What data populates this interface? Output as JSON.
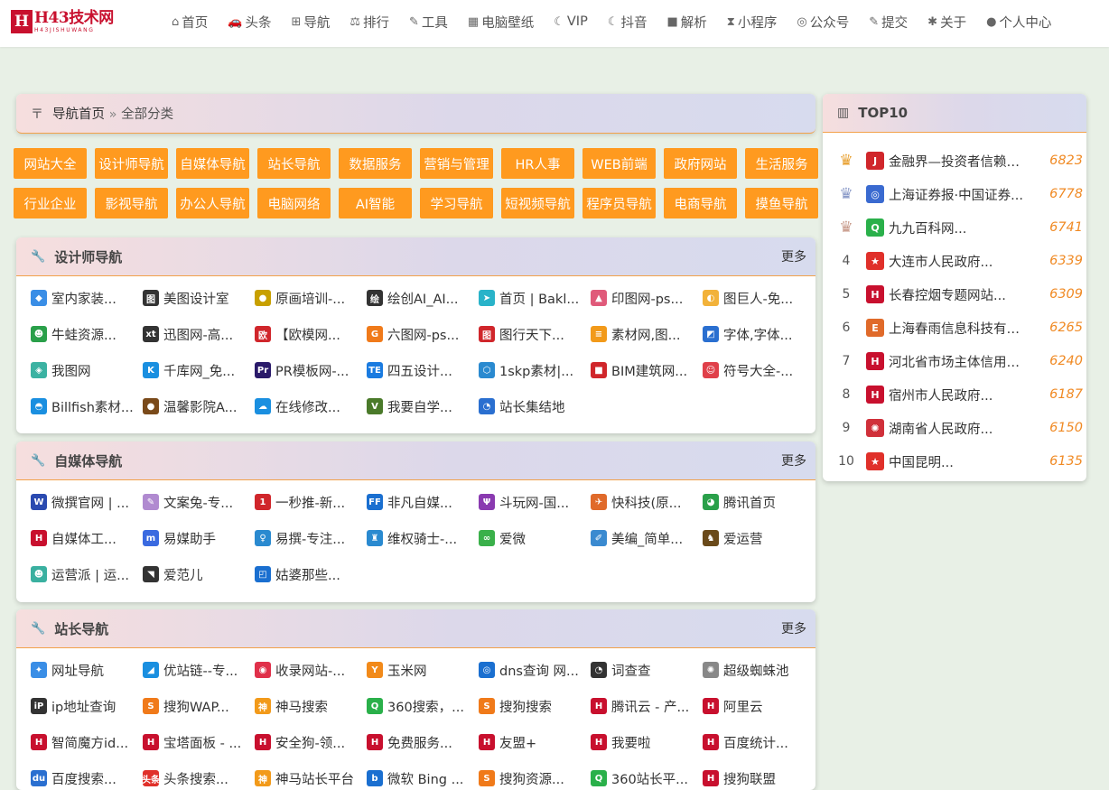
{
  "logo": {
    "mark": "H",
    "main": "H43技术网",
    "sub": "H43JISHUWANG"
  },
  "nav": [
    {
      "icon": "home-icon",
      "glyph": "⌂",
      "label": "首页"
    },
    {
      "icon": "car-icon",
      "glyph": "🚗",
      "label": "头条"
    },
    {
      "icon": "plus-square-icon",
      "glyph": "⊞",
      "label": "导航"
    },
    {
      "icon": "rank-icon",
      "glyph": "⚖",
      "label": "排行"
    },
    {
      "icon": "wrench-icon",
      "glyph": "✎",
      "label": "工具"
    },
    {
      "icon": "chart-icon",
      "glyph": "▦",
      "label": "电脑壁纸"
    },
    {
      "icon": "moon-icon",
      "glyph": "☾",
      "label": "VIP"
    },
    {
      "icon": "moon2-icon",
      "glyph": "☾",
      "label": "抖音"
    },
    {
      "icon": "video-icon",
      "glyph": "■",
      "label": "解析"
    },
    {
      "icon": "hourglass-icon",
      "glyph": "⧗",
      "label": "小程序"
    },
    {
      "icon": "wechat-icon",
      "glyph": "◎",
      "label": "公众号"
    },
    {
      "icon": "edit-icon",
      "glyph": "✎",
      "label": "提交"
    },
    {
      "icon": "bug-icon",
      "glyph": "✱",
      "label": "关于"
    },
    {
      "icon": "user-icon",
      "glyph": "●",
      "label": "个人中心"
    }
  ],
  "breadcrumb": {
    "home": "导航首页",
    "separator": "»",
    "current": "全部分类"
  },
  "categories": [
    "网站大全",
    "设计师导航",
    "自媒体导航",
    "站长导航",
    "数据服务",
    "营销与管理",
    "HR人事",
    "WEB前端",
    "政府网站",
    "生活服务",
    "行业企业",
    "影视导航",
    "办公人导航",
    "电脑网络",
    "AI智能",
    "学习导航",
    "短视频导航",
    "程序员导航",
    "电商导航",
    "摸鱼导航"
  ],
  "more_label": "更多",
  "sections": [
    {
      "title": "设计师导航",
      "links": [
        {
          "text": "室内家装...",
          "fav": "◆",
          "color": "#3a8ee6"
        },
        {
          "text": "美图设计室",
          "fav": "图",
          "color": "#333"
        },
        {
          "text": "原画培训-...",
          "fav": "●",
          "color": "#c8a000"
        },
        {
          "text": "绘创AI_AI...",
          "fav": "绘",
          "color": "#333"
        },
        {
          "text": "首页 | Bakl...",
          "fav": "➤",
          "color": "#29b3c9"
        },
        {
          "text": "印图网-ps...",
          "fav": "▲",
          "color": "#e05a7a"
        },
        {
          "text": "图巨人-免...",
          "fav": "◐",
          "color": "#f2b23a"
        },
        {
          "text": "牛蛙资源...",
          "fav": "☻",
          "color": "#2aa04a"
        },
        {
          "text": "迅图网-高...",
          "fav": "xt",
          "color": "#333"
        },
        {
          "text": "【欧模网...",
          "fav": "欧",
          "color": "#d0262b"
        },
        {
          "text": "六图网-ps...",
          "fav": "G",
          "color": "#f07a1a"
        },
        {
          "text": "图行天下...",
          "fav": "图",
          "color": "#d0262b"
        },
        {
          "text": "素材网,图...",
          "fav": "≡",
          "color": "#f29a1a"
        },
        {
          "text": "字体,字体...",
          "fav": "◩",
          "color": "#2a6fd0"
        },
        {
          "text": "我图网",
          "fav": "◈",
          "color": "#3bb2a2"
        },
        {
          "text": "千库网_免...",
          "fav": "K",
          "color": "#1a8fe0"
        },
        {
          "text": "PR模板网-...",
          "fav": "Pr",
          "color": "#2a1a6a"
        },
        {
          "text": "四五设计...",
          "fav": "TE",
          "color": "#1a7be0"
        },
        {
          "text": "1skp素材|...",
          "fav": "⬡",
          "color": "#2a8ad0"
        },
        {
          "text": "BIM建筑网...",
          "fav": "■",
          "color": "#d0262b"
        },
        {
          "text": "符号大全-...",
          "fav": "☺",
          "color": "#e0404a"
        },
        {
          "text": "Billfish素材...",
          "fav": "◓",
          "color": "#1a8fe0"
        },
        {
          "text": "温馨影院A...",
          "fav": "●",
          "color": "#7a4a1a"
        },
        {
          "text": "在线修改...",
          "fav": "☁",
          "color": "#1a8fe0"
        },
        {
          "text": "我要自学...",
          "fav": "V",
          "color": "#4a7a2a"
        },
        {
          "text": "站长集结地",
          "fav": "◔",
          "color": "#2a6fd0"
        }
      ]
    },
    {
      "title": "自媒体导航",
      "links": [
        {
          "text": "微撰官网 | ...",
          "fav": "W",
          "color": "#2a4ab0"
        },
        {
          "text": "文案兔-专...",
          "fav": "✎",
          "color": "#b08ad0"
        },
        {
          "text": "一秒推-新...",
          "fav": "1",
          "color": "#d0262b"
        },
        {
          "text": "非凡自媒...",
          "fav": "FF",
          "color": "#1a6fd0"
        },
        {
          "text": "斗玩网-国...",
          "fav": "Ψ",
          "color": "#8a3ab0"
        },
        {
          "text": "快科技(原...",
          "fav": "✈",
          "color": "#e06a2a"
        },
        {
          "text": "腾讯首页",
          "fav": "◕",
          "color": "#2aa04a"
        },
        {
          "text": "自媒体工...",
          "fav": "H",
          "color": "#c8102e"
        },
        {
          "text": "易媒助手",
          "fav": "m",
          "color": "#3a6ae0"
        },
        {
          "text": "易撰-专注...",
          "fav": "♀",
          "color": "#2a8ad0"
        },
        {
          "text": "维权骑士-...",
          "fav": "♜",
          "color": "#2a8ad0"
        },
        {
          "text": "爱微",
          "fav": "∞",
          "color": "#3ab04a"
        },
        {
          "text": "美编_简单...",
          "fav": "✐",
          "color": "#3a8ad0"
        },
        {
          "text": "爱运营",
          "fav": "♞",
          "color": "#6a4a1a"
        },
        {
          "text": "运营派 | 运...",
          "fav": "☻",
          "color": "#3ab0a0"
        },
        {
          "text": "爱范儿",
          "fav": "◥",
          "color": "#333"
        },
        {
          "text": "姑婆那些...",
          "fav": "◰",
          "color": "#1a6fd0"
        }
      ]
    },
    {
      "title": "站长导航",
      "links": [
        {
          "text": "网址导航",
          "fav": "✦",
          "color": "#3a8ee6"
        },
        {
          "text": "优站链--专...",
          "fav": "◢",
          "color": "#1a8fe0"
        },
        {
          "text": "收录网站-...",
          "fav": "◉",
          "color": "#e0304a"
        },
        {
          "text": "玉米网",
          "fav": "Y",
          "color": "#f28a1a"
        },
        {
          "text": "dns查询 网...",
          "fav": "◎",
          "color": "#1a6fd0"
        },
        {
          "text": "词查查",
          "fav": "◔",
          "color": "#333"
        },
        {
          "text": "超级蜘蛛池",
          "fav": "✺",
          "color": "#888"
        },
        {
          "text": "ip地址查询",
          "fav": "iP",
          "color": "#333"
        },
        {
          "text": "搜狗WAP...",
          "fav": "S",
          "color": "#f07a1a"
        },
        {
          "text": "神马搜索",
          "fav": "神",
          "color": "#f29a1a"
        },
        {
          "text": "360搜索，...",
          "fav": "Q",
          "color": "#2ab04a"
        },
        {
          "text": "搜狗搜索",
          "fav": "S",
          "color": "#f07a1a"
        },
        {
          "text": "腾讯云 - 产...",
          "fav": "H",
          "color": "#c8102e"
        },
        {
          "text": "阿里云",
          "fav": "H",
          "color": "#c8102e"
        },
        {
          "text": "智简魔方id...",
          "fav": "H",
          "color": "#c8102e"
        },
        {
          "text": "宝塔面板 - ...",
          "fav": "H",
          "color": "#c8102e"
        },
        {
          "text": "安全狗-领...",
          "fav": "H",
          "color": "#c8102e"
        },
        {
          "text": "免费服务...",
          "fav": "H",
          "color": "#c8102e"
        },
        {
          "text": "友盟+",
          "fav": "H",
          "color": "#c8102e"
        },
        {
          "text": "我要啦",
          "fav": "H",
          "color": "#c8102e"
        },
        {
          "text": "百度统计...",
          "fav": "H",
          "color": "#c8102e"
        },
        {
          "text": "百度搜索...",
          "fav": "du",
          "color": "#2a6fd0"
        },
        {
          "text": "头条搜索...",
          "fav": "头条",
          "color": "#e0302a"
        },
        {
          "text": "神马站长平台",
          "fav": "神",
          "color": "#f29a1a"
        },
        {
          "text": "微软 Bing ...",
          "fav": "b",
          "color": "#1a6fd0"
        },
        {
          "text": "搜狗资源...",
          "fav": "S",
          "color": "#f07a1a"
        },
        {
          "text": "360站长平...",
          "fav": "Q",
          "color": "#2ab04a"
        },
        {
          "text": "搜狗联盟",
          "fav": "H",
          "color": "#c8102e"
        }
      ]
    }
  ],
  "top10": {
    "title": "TOP10",
    "items": [
      {
        "rank": "1",
        "name": "金融界—投资者信赖的...",
        "count": "6823",
        "fav": "J",
        "color": "#d0262b",
        "crown": "#e8a030"
      },
      {
        "rank": "2",
        "name": "上海证券报·中国证券...",
        "count": "6778",
        "fav": "◎",
        "color": "#3a6ad0",
        "crown": "#8a9ac8"
      },
      {
        "rank": "3",
        "name": "九九百科网...",
        "count": "6741",
        "fav": "Q",
        "color": "#2ab04a",
        "crown": "#c89a8a"
      },
      {
        "rank": "4",
        "name": "大连市人民政府...",
        "count": "6339",
        "fav": "★",
        "color": "#e0302a"
      },
      {
        "rank": "5",
        "name": "长春控烟专题网站...",
        "count": "6309",
        "fav": "H",
        "color": "#c8102e"
      },
      {
        "rank": "6",
        "name": "上海春雨信息科技有限...",
        "count": "6265",
        "fav": "E",
        "color": "#e06a2a"
      },
      {
        "rank": "7",
        "name": "河北省市场主体信用信...",
        "count": "6240",
        "fav": "H",
        "color": "#c8102e"
      },
      {
        "rank": "8",
        "name": "宿州市人民政府...",
        "count": "6187",
        "fav": "H",
        "color": "#c8102e"
      },
      {
        "rank": "9",
        "name": "湖南省人民政府...",
        "count": "6150",
        "fav": "✺",
        "color": "#d0303a"
      },
      {
        "rank": "10",
        "name": "中国昆明...",
        "count": "6135",
        "fav": "★",
        "color": "#e0302a"
      }
    ]
  }
}
